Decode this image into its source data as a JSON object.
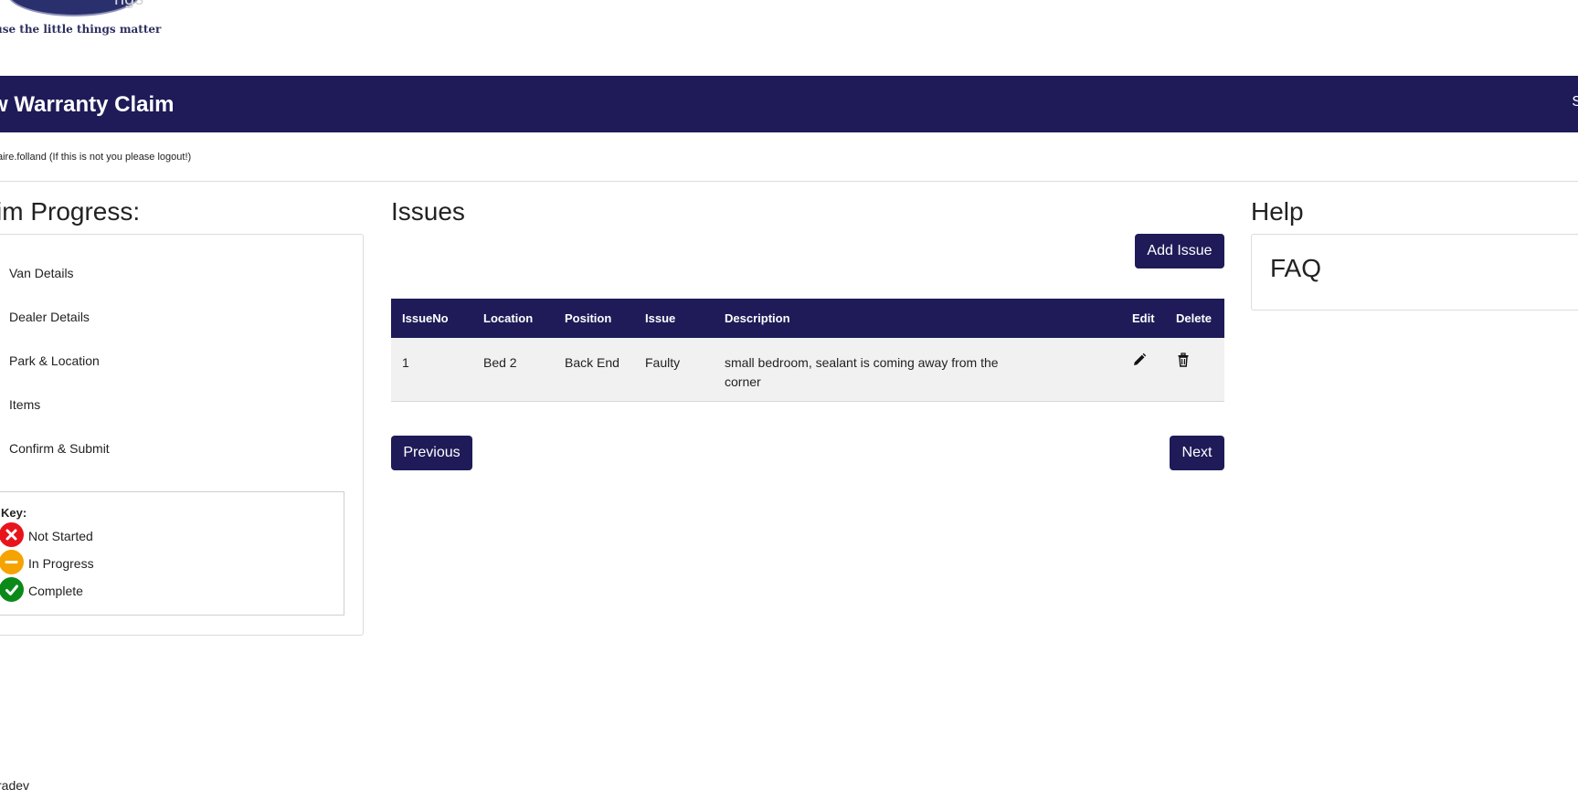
{
  "header": {
    "tagline": "use the little things matter",
    "logo_ghost_text": "ngs",
    "banner_title": "w Warranty Claim",
    "banner_edge_text": "S",
    "user_line": "aire.folland (If this is not you please logout!)"
  },
  "progress": {
    "title": "im Progress:",
    "steps": [
      {
        "label": "Van Details",
        "status": "complete"
      },
      {
        "label": "Dealer Details",
        "status": "complete"
      },
      {
        "label": "Park & Location",
        "status": "complete"
      },
      {
        "label": "Items",
        "status": "in-progress"
      },
      {
        "label": "Confirm & Submit",
        "status": "not-started"
      }
    ],
    "key": {
      "title": "Key:",
      "items": [
        {
          "label": "Not Started",
          "icon": "x-circle-icon",
          "color": "#e8141c"
        },
        {
          "label": "In Progress",
          "icon": "minus-circle-icon",
          "color": "#f5a300"
        },
        {
          "label": "Complete",
          "icon": "check-circle-icon",
          "color": "#0b8a1a"
        }
      ]
    }
  },
  "issues": {
    "title": "Issues",
    "add_button": "Add Issue",
    "columns": [
      "IssueNo",
      "Location",
      "Position",
      "Issue",
      "Description",
      "Edit",
      "Delete"
    ],
    "rows": [
      {
        "issue_no": "1",
        "location": "Bed 2",
        "position": "Back End",
        "issue": "Faulty",
        "description": "small bedroom, sealant is coming away from the corner"
      }
    ],
    "previous_button": "Previous",
    "next_button": "Next"
  },
  "help": {
    "title": "Help",
    "faq": "FAQ"
  },
  "footer": {
    "text": "radev"
  },
  "colors": {
    "navy": "#1e1b58",
    "complete": "#0b8a1a",
    "in_progress": "#f5a300",
    "not_started": "#e8141c"
  }
}
